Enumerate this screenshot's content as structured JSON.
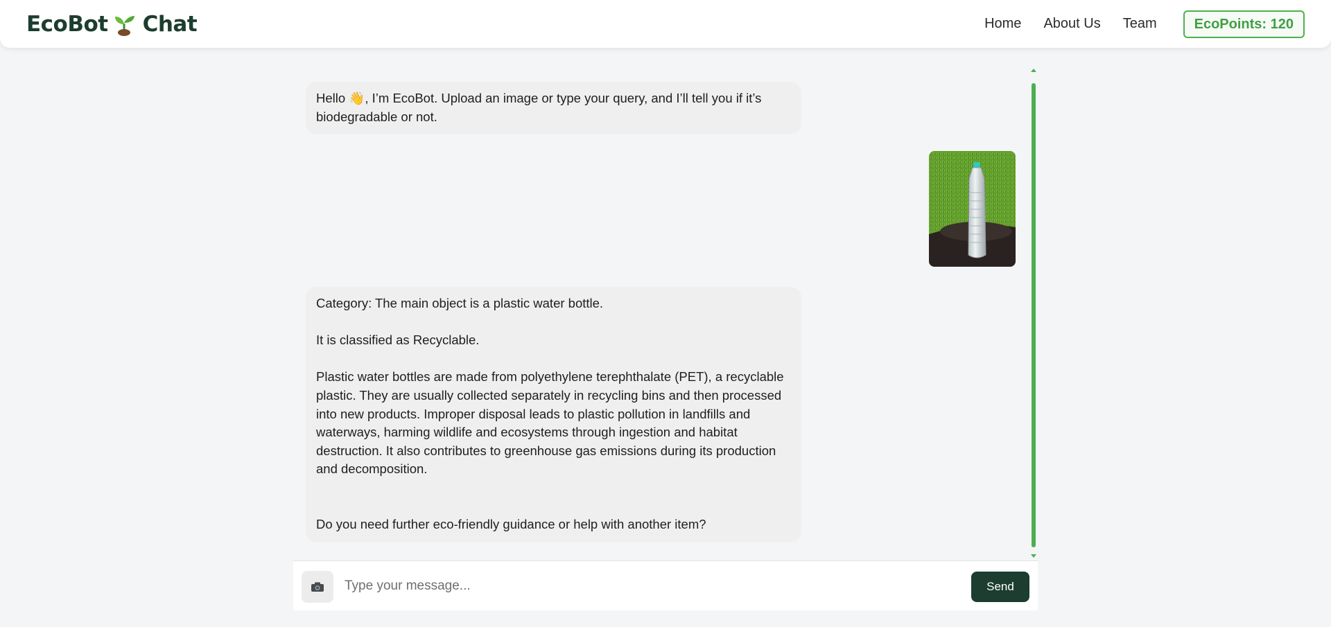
{
  "header": {
    "brand_left": "EcoBot",
    "brand_right": "Chat",
    "nav": {
      "home": "Home",
      "about": "About Us",
      "team": "Team"
    },
    "ecopoints_label": "EcoPoints: 120"
  },
  "chat": {
    "greeting": {
      "text_before_emoji": "Hello ",
      "emoji": "👋",
      "text_after_emoji": ", I’m EcoBot. Upload an image or type your query, and I’ll tell you if it’s biodegradable or not."
    },
    "reply": {
      "category": "Category: The main object is a plastic water bottle.",
      "classification": "It is classified as Recyclable.",
      "details": "Plastic water bottles are made from polyethylene terephthalate (PET), a recyclable plastic. They are usually collected separately in recycling bins and then processed into new products. Improper disposal leads to plastic pollution in landfills and waterways, harming wildlife and ecosystems through ingestion and habitat destruction. It also contributes to greenhouse gas emissions during its production and decomposition.",
      "followup": "Do you need further eco-friendly guidance or help with another item?"
    }
  },
  "input": {
    "placeholder": "Type your message...",
    "send_label": "Send",
    "camera_icon": "camera-icon"
  },
  "colors": {
    "brand_dark": "#1c3d2f",
    "accent_green": "#4caf50",
    "bubble_bg": "#efefef",
    "page_bg": "#f4f5f7"
  }
}
